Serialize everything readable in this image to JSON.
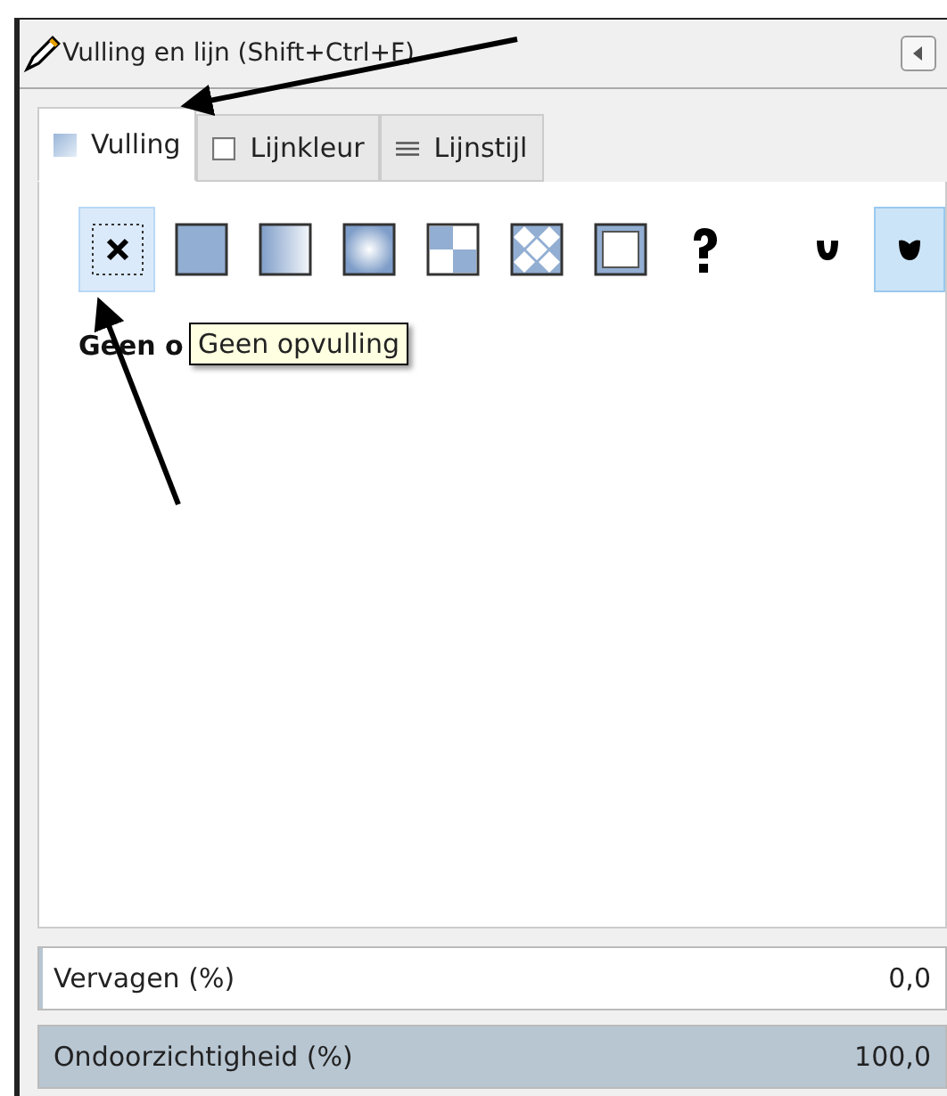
{
  "window": {
    "title": "Vulling en lijn (Shift+Ctrl+F)"
  },
  "tabs": [
    {
      "label": "Vulling",
      "selected": true
    },
    {
      "label": "Lijnkleur",
      "selected": false
    },
    {
      "label": "Lijnstijl",
      "selected": false
    }
  ],
  "fill_types": [
    {
      "kind": "none",
      "selected": true
    },
    {
      "kind": "flat",
      "selected": false
    },
    {
      "kind": "linear",
      "selected": false
    },
    {
      "kind": "radial",
      "selected": false
    },
    {
      "kind": "mesh",
      "selected": false
    },
    {
      "kind": "pattern",
      "selected": false
    },
    {
      "kind": "swatch",
      "selected": false
    },
    {
      "kind": "unset",
      "selected": false
    }
  ],
  "fill_rules": [
    {
      "kind": "evenodd",
      "selected": false
    },
    {
      "kind": "nonzero",
      "selected": true
    }
  ],
  "fill_label": "Geen o",
  "tooltip": "Geen opvulling",
  "sliders": [
    {
      "label": "Vervagen (%)",
      "reading": "0,0",
      "level": 0
    },
    {
      "label": "Ondoorzichtigheid (%)",
      "reading": "100,0",
      "level": 1
    }
  ]
}
